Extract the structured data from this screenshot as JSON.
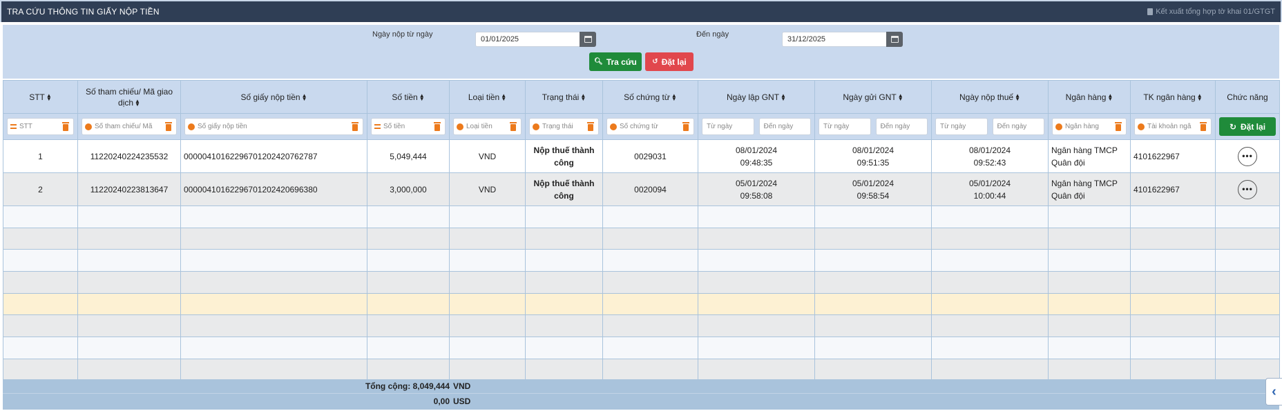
{
  "header": {
    "title": "TRA CỨU THÔNG TIN GIẤY NỘP TIỀN",
    "export_label": "Kết xuất tổng hợp tờ khai 01/GTGT"
  },
  "filters": {
    "from_label": "Ngày nộp từ ngày",
    "from_value": "01/01/2025",
    "to_label": "Đến ngày",
    "to_value": "31/12/2025",
    "search_label": "Tra cứu",
    "reset_label": "Đặt lại"
  },
  "columns": {
    "stt": "STT",
    "ref": "Số tham chiếu/ Mã giao dịch",
    "paper": "Số giấy nộp tiền",
    "amount": "Số tiền",
    "currency": "Loại tiền",
    "status": "Trạng thái",
    "voucher": "Số chứng từ",
    "created": "Ngày lập GNT",
    "sent": "Ngày gửi GNT",
    "paid": "Ngày nộp thuế",
    "bank": "Ngân hàng",
    "account": "TK ngân hàng",
    "actions": "Chức năng"
  },
  "column_filters": {
    "stt": "STT",
    "ref": "Số tham chiếu/ Mã",
    "paper": "Số giấy nộp tiền",
    "amount": "Số tiền",
    "currency": "Loại tiền",
    "status": "Trạng thái",
    "voucher": "Số chứng từ",
    "from_date": "Từ ngày",
    "to_date": "Đến ngày",
    "bank": "Ngân hàng",
    "account": "Tài khoản ngâ",
    "reset_label": "Đặt lại"
  },
  "rows": [
    {
      "stt": "1",
      "ref": "11220240224235532",
      "paper": "00000410162296701202420762787",
      "amount": "5,049,444",
      "currency": "VND",
      "status": "Nộp thuế thành công",
      "voucher": "0029031",
      "created_date": "08/01/2024",
      "created_time": "09:48:35",
      "sent_date": "08/01/2024",
      "sent_time": "09:51:35",
      "paid_date": "08/01/2024",
      "paid_time": "09:52:43",
      "bank": "Ngân hàng TMCP Quân đội",
      "account": "4101622967"
    },
    {
      "stt": "2",
      "ref": "11220240223813647",
      "paper": "00000410162296701202420696380",
      "amount": "3,000,000",
      "currency": "VND",
      "status": "Nộp thuế thành công",
      "voucher": "0020094",
      "created_date": "05/01/2024",
      "created_time": "09:58:08",
      "sent_date": "05/01/2024",
      "sent_time": "09:58:54",
      "paid_date": "05/01/2024",
      "paid_time": "10:00:44",
      "bank": "Ngân hàng TMCP Quân đội",
      "account": "4101622967"
    }
  ],
  "totals": {
    "label": "Tổng cộng:",
    "vnd_amount": "8,049,444",
    "vnd_currency": "VND",
    "usd_amount": "0,00",
    "usd_currency": "USD"
  },
  "colors": {
    "title_bg": "#2f3e55",
    "panel_bg": "#c9d9ee",
    "primary_green": "#1f8b3a",
    "danger_red": "#e1474d",
    "filter_accent": "#ec7a1c",
    "highlight_row": "#fdf1d3"
  }
}
